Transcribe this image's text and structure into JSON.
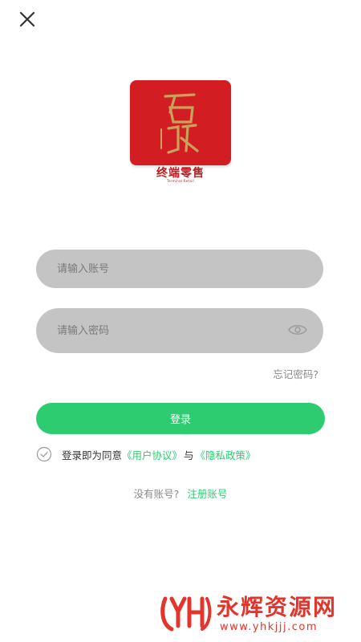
{
  "header": {
    "close_icon": "close-icon"
  },
  "brand": {
    "name_cn": "终端零售",
    "name_en": "Terminal Retail",
    "color": "#d21e22"
  },
  "form": {
    "account_placeholder": "请输入账号",
    "password_placeholder": "请输入密码",
    "eye_icon": "eye-icon",
    "forgot_label": "忘记密码?",
    "login_label": "登录"
  },
  "agreement": {
    "prefix": "登录即为同意",
    "user_agreement": "《用户协议》",
    "and_text": "与",
    "privacy_policy": "《隐私政策》"
  },
  "register": {
    "prompt": "没有账号?",
    "link_label": "注册账号"
  },
  "watermark": {
    "title": "永辉资源网",
    "url": "www.yhkjjj.com"
  },
  "colors": {
    "accent": "#2ecc71",
    "input_bg": "#c4c4c4",
    "watermark": "#e2352c"
  }
}
